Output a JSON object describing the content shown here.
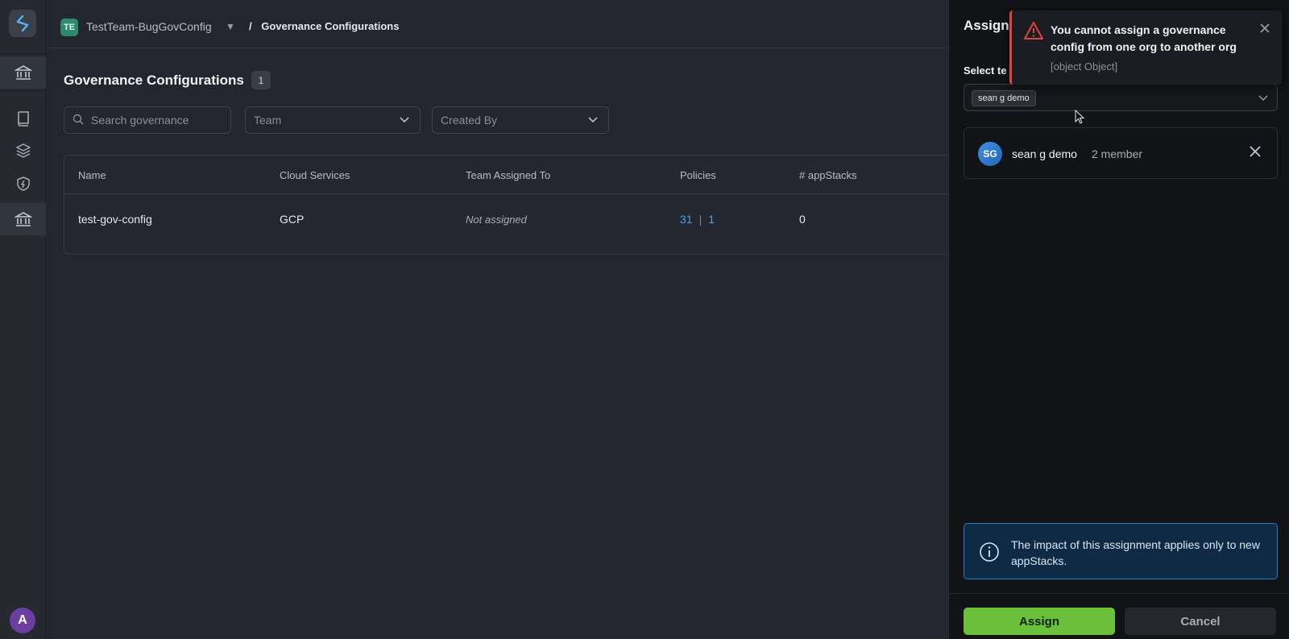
{
  "topbar": {
    "team_initials": "TE",
    "team_name": "TestTeam-BugGovConfig",
    "breadcrumb_sep": "/",
    "breadcrumb": "Governance Configurations"
  },
  "main": {
    "title": "Governance Configurations",
    "count": "1",
    "search_placeholder": "Search governance",
    "filter_team": "Team",
    "filter_created_by": "Created By"
  },
  "table": {
    "headers": [
      "Name",
      "Cloud Services",
      "Team Assigned To",
      "Policies",
      "# appStacks"
    ],
    "rows": [
      {
        "name": "test-gov-config",
        "cloud": "GCP",
        "team": "Not assigned",
        "policies_a": "31",
        "policies_sep": "|",
        "policies_b": "1",
        "appstacks": "0"
      }
    ]
  },
  "drawer": {
    "title": "Assign",
    "select_label": "Select te",
    "selected_chip": "sean g demo",
    "member": {
      "initials": "SG",
      "name": "sean g demo",
      "count": "2 member"
    },
    "info_text": "The impact of this assignment applies only to new appStacks.",
    "assign_label": "Assign",
    "cancel_label": "Cancel"
  },
  "toast": {
    "title": "You cannot assign a governance config from one org to another org",
    "subtitle": "[object Object]"
  },
  "sidebar": {
    "user_initial": "A"
  },
  "colors": {
    "accent_green": "#6abf3b",
    "link_blue": "#4da3ea",
    "error_red": "#e0443c",
    "info_blue": "#2f7bc4"
  },
  "icons": [
    "logo-icon",
    "bank-icon",
    "book-icon",
    "layers-icon",
    "shield-icon",
    "bank-icon",
    "search-icon",
    "chevron-down-icon",
    "close-icon",
    "warning-icon",
    "info-icon"
  ]
}
